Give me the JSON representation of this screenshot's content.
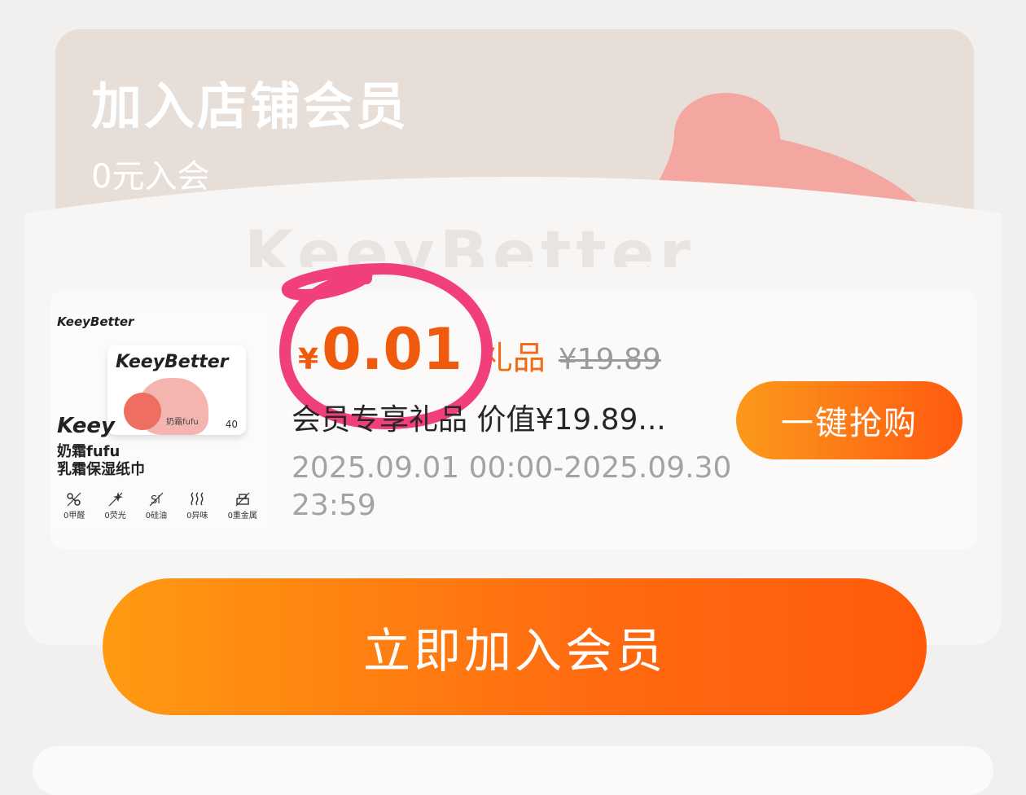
{
  "banner": {
    "title": "加入店铺会员",
    "subtitle": "0元入会",
    "watermark": "KeeyBetter"
  },
  "product": {
    "brand": "KeeyBetter",
    "box_brand": "KeeyBetter",
    "box_sub": "奶霜fufu",
    "box_count": "40",
    "logo": "Keey",
    "name_line1": "奶霜fufu",
    "name_line2": "乳霜保湿纸巾",
    "badges": [
      "0甲醛",
      "0荧光",
      "0硅油",
      "0异味",
      "0重金属"
    ]
  },
  "offer": {
    "currency": "¥",
    "price": "0.01",
    "gift_label": "礼品",
    "original_price": "¥19.89",
    "description": "会员专享礼品 价值¥19.89...",
    "time_range": "2025.09.01 00:00-2025.09.30 23:59",
    "grab_button": "一键抢购"
  },
  "actions": {
    "join_button": "立即加入会员"
  },
  "colors": {
    "accent": "#f05a0c",
    "highlight_circle": "#f03f7b",
    "banner_bg": "#e7ded7",
    "banner_blob": "#f4a7a1"
  }
}
